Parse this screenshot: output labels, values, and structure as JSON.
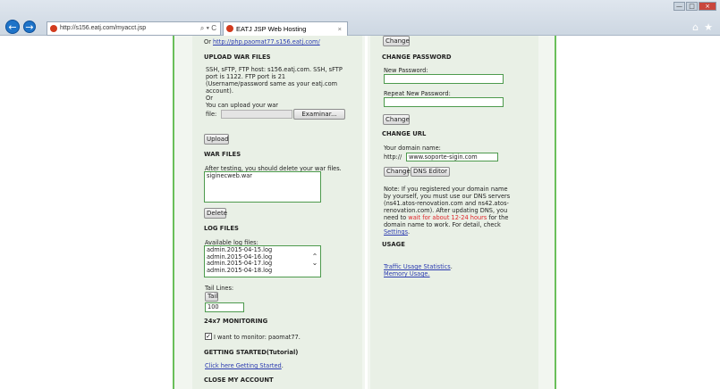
{
  "browser": {
    "url": "http://s156.eatj.com/myacct.jsp",
    "addr_controls": "⌕ ▾ C",
    "tab_title": "EATJ JSP Web Hosting",
    "tab_close": "×",
    "back": "←",
    "forward": "→",
    "win_min": "—",
    "win_max": "□",
    "win_close": "×",
    "home_icon": "⌂",
    "star_icon": "★"
  },
  "left": {
    "top_text": "Or http://php.paomat77.s156.eatj.com/",
    "top_prefix": "Or ",
    "top_link": "http://php.paomat77.s156.eatj.com/",
    "upload": {
      "heading": "UPLOAD WAR FILES",
      "lines": [
        "SSH, sFTP, FTP host: s156.eatj.com. SSH, sFTP",
        "port is 1122. FTP port is 21",
        "(Username/password same as your eatj.com",
        "account).",
        "Or",
        "You can upload your war"
      ],
      "file_label": "file:",
      "browse_label": "Examinar...",
      "upload_button": "Upload"
    },
    "war": {
      "heading": "WAR FILES",
      "note": "After testing, you should delete your war files.",
      "files": [
        "siginecweb.war"
      ],
      "delete_button": "Delete"
    },
    "logs": {
      "heading": "LOG FILES",
      "available_label": "Available log files:",
      "files": [
        "admin.2015-04-15.log",
        "admin.2015-04-16.log",
        "admin.2015-04-17.log",
        "admin.2015-04-18.log"
      ],
      "tail_lines_label": "Tail Lines:",
      "tail_button": "Tail",
      "tail_value": "100"
    },
    "monitoring": {
      "heading": "24x7 MONITORING",
      "checkbox_label": "I want to monitor: paomat77.",
      "checked": true
    },
    "getting_started": {
      "heading": "GETTING STARTED(Tutorial)",
      "link": "Click here Getting Started",
      "link_suffix": "."
    },
    "close_account": {
      "heading": "CLOSE MY ACCOUNT"
    }
  },
  "right": {
    "change_top_button": "Change",
    "password": {
      "heading": "CHANGE PASSWORD",
      "new_label": "New Password:",
      "repeat_label": "Repeat New Password:",
      "change_button": "Change"
    },
    "url": {
      "heading": "CHANGE URL",
      "domain_label": "Your domain name:",
      "prefix": "http://",
      "domain_value": "www.soporte-sigin.com",
      "change_button": "Change",
      "dns_button": "DNS Editor",
      "note_lines": [
        "Note: If you registered your domain name",
        "by yourself, you must use our DNS servers",
        "(ns41.atos-renovation.com and ns42.atos-",
        "renovation.com). After updating DNS, you"
      ],
      "note_wait_prefix": "need to ",
      "note_wait": "wait for about 12-24 hours",
      "note_wait_suffix": " for the",
      "note_line6": "domain name to work. For detail, check",
      "settings_link": "Settings",
      "settings_suffix": "."
    },
    "usage": {
      "heading": "USAGE",
      "traffic_link": "Traffic Usage Statistics",
      "traffic_suffix": ".",
      "memory_link": "Memory Usage."
    }
  }
}
